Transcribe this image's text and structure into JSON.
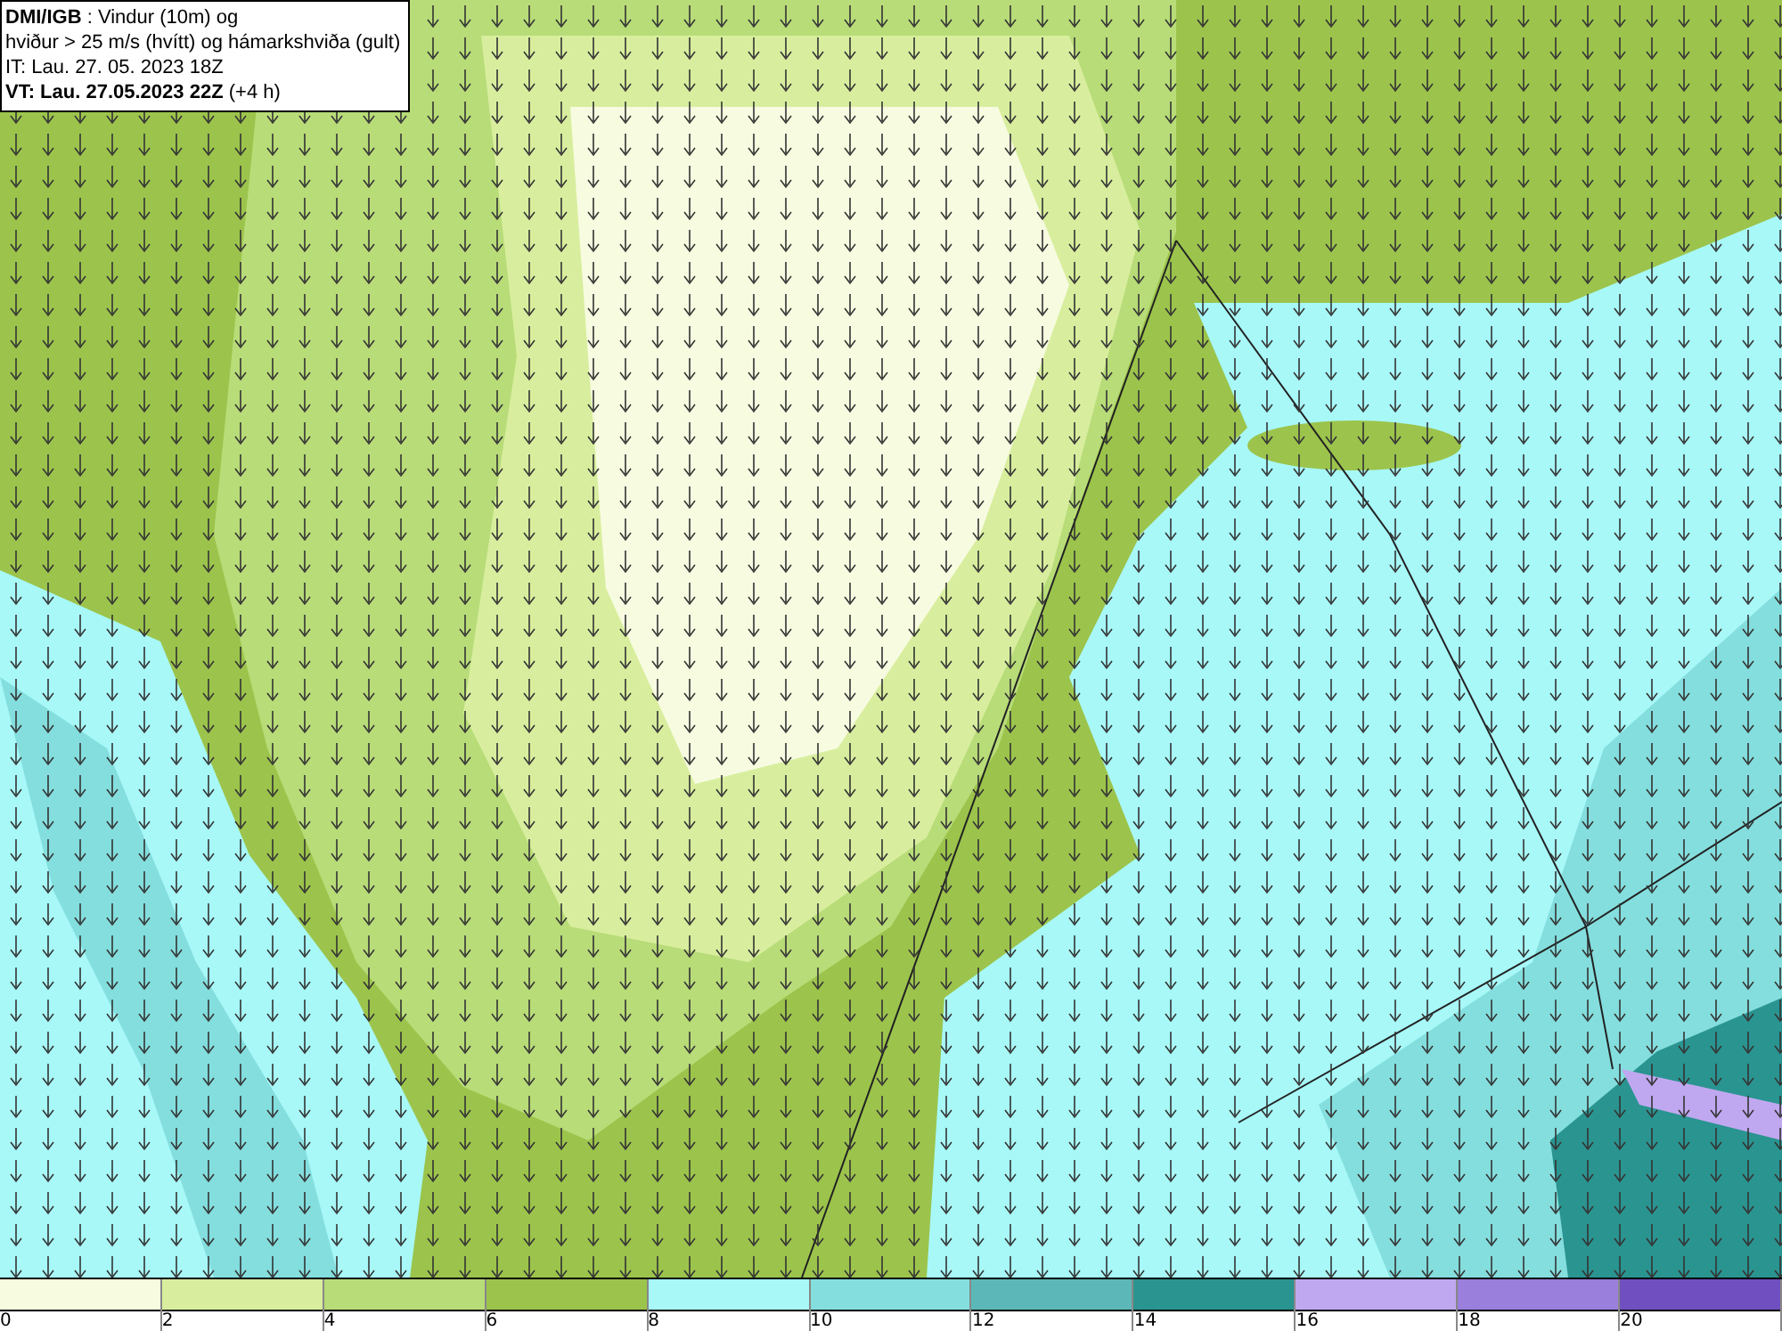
{
  "info": {
    "lines": [
      "**DMI/IGB** : Vindur (10m) og",
      "hviður > 25 m/s (hvítt) og hámarkshviða (gult)",
      "IT: Lau. 27. 05. 2023 18Z",
      "**VT: Lau. 27.05.2023 22Z** (+4 h)"
    ]
  },
  "legend": {
    "bins": [
      {
        "color": "#f7fbe0",
        "label": "0"
      },
      {
        "color": "#d8ee9e",
        "label": "2"
      },
      {
        "color": "#b8dc78",
        "label": "4"
      },
      {
        "color": "#9cc44c",
        "label": "6"
      },
      {
        "color": "#a8f8f8",
        "label": "8"
      },
      {
        "color": "#84dede",
        "label": "10"
      },
      {
        "color": "#5cb8b8",
        "label": "12"
      },
      {
        "color": "#2a9490",
        "label": "14"
      },
      {
        "color": "#c0a8f0",
        "label": "16"
      },
      {
        "color": "#9a7fdc",
        "label": "18"
      },
      {
        "color": "#7050c0",
        "label": "20"
      }
    ]
  }
}
